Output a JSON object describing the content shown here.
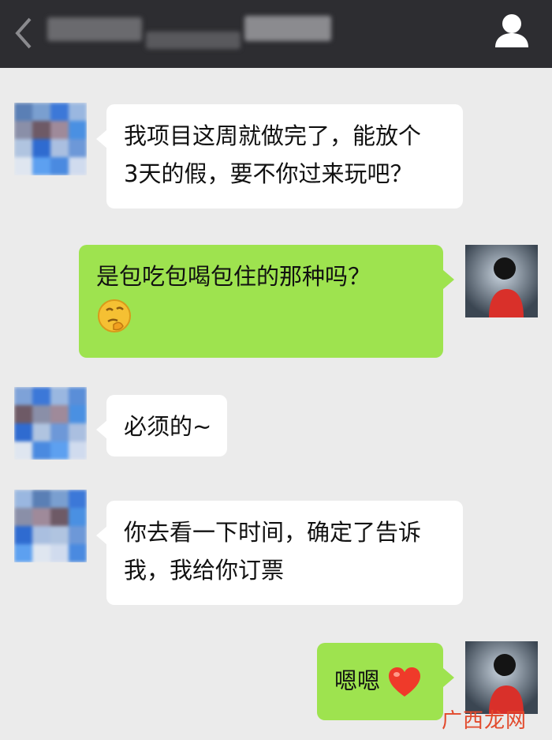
{
  "header": {
    "back_icon": "chevron-left-icon",
    "contact_name": "",
    "profile_icon": "person-icon"
  },
  "colors": {
    "header_bg": "#2d2d31",
    "chat_bg": "#ebebeb",
    "incoming_bubble": "#ffffff",
    "outgoing_bubble": "#9ee34f"
  },
  "messages": [
    {
      "side": "in",
      "lines": [
        "我项目这周就做完了，能放个",
        "3天的假，要不你过来玩吧？"
      ]
    },
    {
      "side": "out",
      "lines": [
        "是包吃包喝包住的那种吗？"
      ],
      "emoji": "thinking-face-icon"
    },
    {
      "side": "in",
      "lines": [
        "必须的~"
      ]
    },
    {
      "side": "in",
      "lines": [
        "你去看一下时间，确定了告诉",
        "我，我给你订票"
      ]
    },
    {
      "side": "out",
      "lines": [
        "嗯嗯"
      ],
      "emoji": "red-heart-icon"
    }
  ],
  "watermark": {
    "text": "广西龙网"
  }
}
